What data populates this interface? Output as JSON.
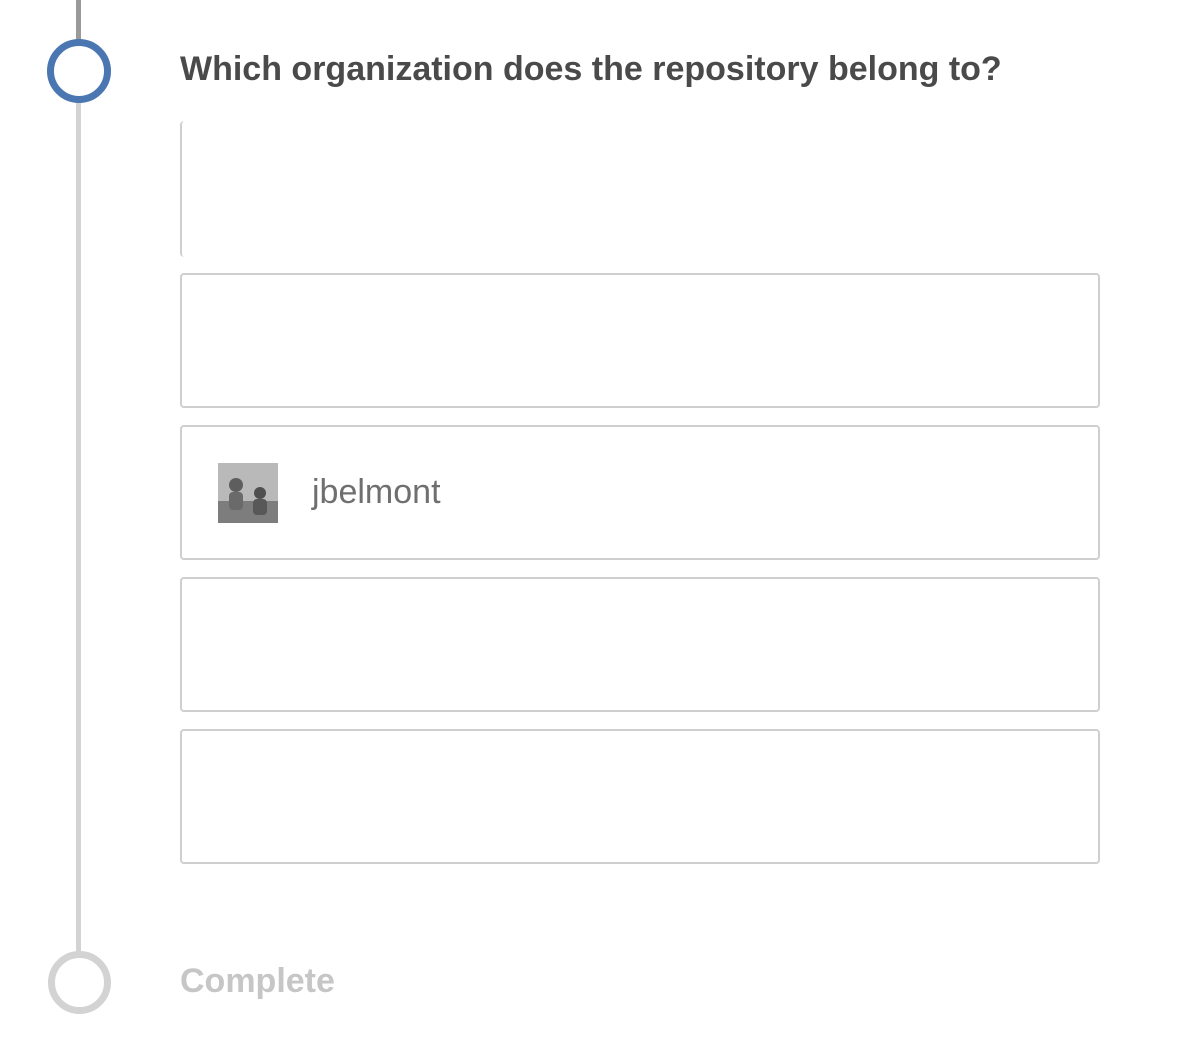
{
  "question": "Which organization does the repository belong to?",
  "options": [
    {
      "label": ""
    },
    {
      "label": ""
    },
    {
      "label": "jbelmont",
      "avatar": "user-avatar-photo"
    },
    {
      "label": ""
    },
    {
      "label": ""
    }
  ],
  "steps": {
    "complete_label": "Complete"
  },
  "colors": {
    "active_step": "#4a76b1",
    "inactive_step": "#d3d3d3",
    "question_text": "#4a4a4a",
    "complete_text": "#c6c6c6",
    "option_border": "#cfcfcf"
  }
}
